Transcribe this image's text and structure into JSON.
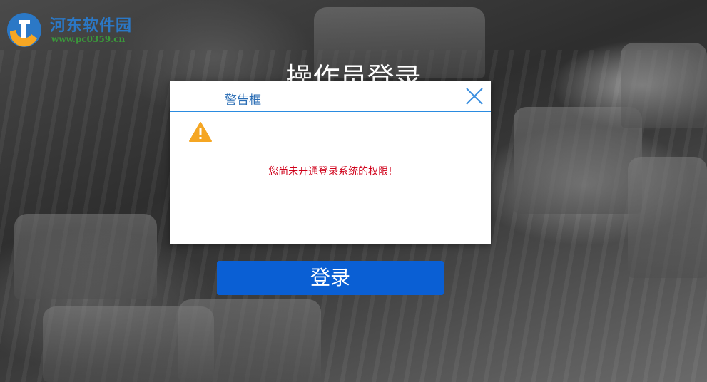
{
  "watermark": {
    "title": "河东软件园",
    "url": "www.pc0359.cn"
  },
  "page": {
    "title": "操作员登录",
    "login_button": "登录"
  },
  "dialog": {
    "title": "警告框",
    "message": "您尚未开通登录系统的权限!",
    "icon": "warning-icon",
    "close_icon": "close-icon"
  },
  "colors": {
    "accent": "#0a5fd4",
    "dialog_title": "#2a6db5",
    "message": "#d0021b",
    "warning": "#f5a623"
  }
}
